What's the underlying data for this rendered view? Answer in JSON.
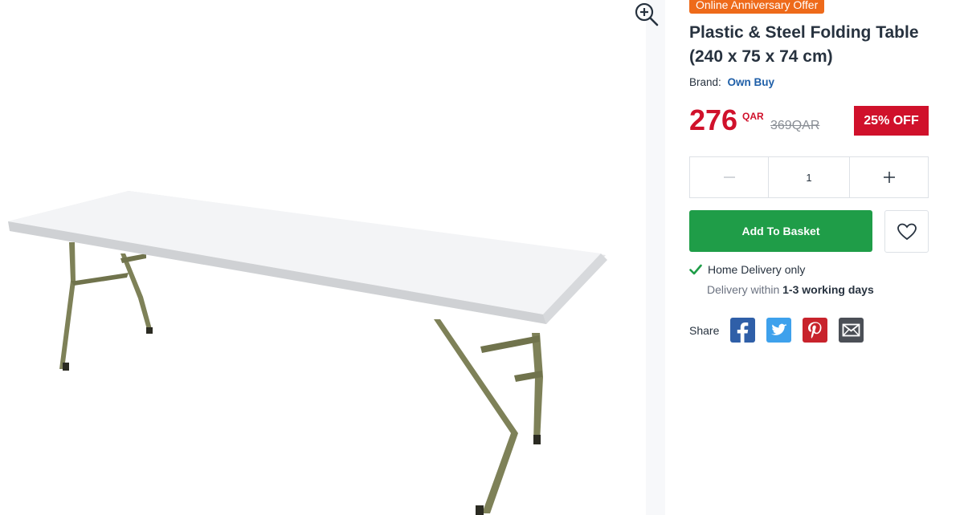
{
  "offer_tag": "Online Anniversary Offer",
  "product": {
    "title": "Plastic & Steel Folding Table (240 x 75 x 74 cm)",
    "brand_label": "Brand:",
    "brand_name": "Own Buy"
  },
  "price": {
    "current": "276",
    "currency": "QAR",
    "old": "369QAR",
    "discount": "25% OFF"
  },
  "quantity": {
    "value": "1",
    "decrement_icon": "minus-icon",
    "increment_icon": "plus-icon"
  },
  "actions": {
    "add_to_basket": "Add To Basket",
    "wishlist_icon": "heart-icon"
  },
  "delivery": {
    "option": "Home Delivery only",
    "within_label": "Delivery within",
    "within_value": "1-3 working days"
  },
  "share": {
    "label": "Share",
    "networks": [
      "facebook",
      "twitter",
      "pinterest",
      "email"
    ]
  },
  "colors": {
    "offer": "#ee6a1a",
    "price": "#d0112b",
    "basket": "#1f9d48",
    "brand_link": "#1f5fa8",
    "facebook": "#2f5fa8",
    "twitter": "#3ea1ec",
    "pinterest": "#c8232c",
    "email": "#4b4f56"
  }
}
